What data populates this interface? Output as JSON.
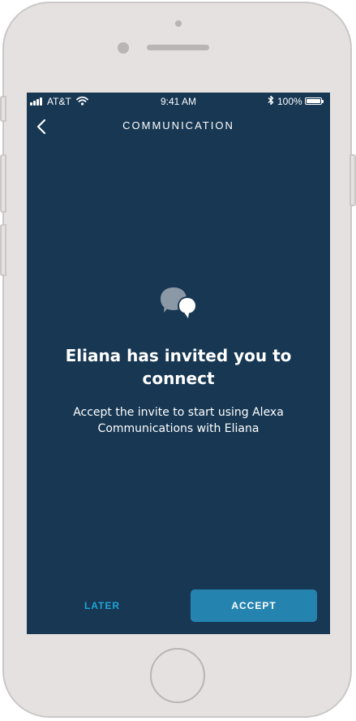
{
  "device": {
    "frame_color": "#e5e1e1"
  },
  "status_bar": {
    "carrier": "AT&T",
    "time": "9:41 AM",
    "battery_percent": "100%"
  },
  "nav": {
    "title": "COMMUNICATION",
    "back_icon": "chevron-left-icon"
  },
  "main": {
    "icon": "chat-bubbles-icon",
    "headline": "Eliana has invited you to connect",
    "body": "Accept the invite to start using Alexa Communications with Eliana"
  },
  "actions": {
    "later_label": "LATER",
    "accept_label": "ACCEPT"
  },
  "colors": {
    "screen_background": "#173753",
    "accent": "#1ea5d6",
    "primary_button": "#2583b0"
  }
}
